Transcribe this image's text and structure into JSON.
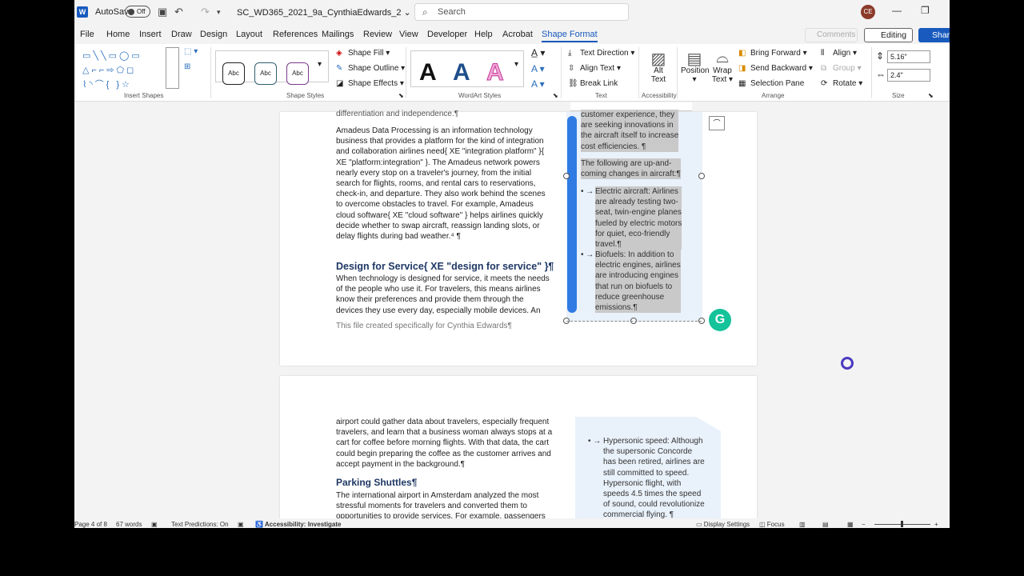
{
  "titlebar": {
    "autosave_label": "AutoSave",
    "autosave_state": "Off",
    "doc_title": "SC_WD365_2021_9a_CynthiaEdwards_2",
    "search_placeholder": "Search",
    "avatar_initials": "CE"
  },
  "tabs": [
    "File",
    "Home",
    "Insert",
    "Draw",
    "Design",
    "Layout",
    "References",
    "Mailings",
    "Review",
    "View",
    "Developer",
    "Help",
    "Acrobat",
    "Shape Format"
  ],
  "active_tab": "Shape Format",
  "tab_buttons": {
    "comments": "Comments",
    "editing": "Editing",
    "share": "Share"
  },
  "ribbon": {
    "groups": {
      "insert_shapes": "Insert Shapes",
      "shape_styles": "Shape Styles",
      "wordart_styles": "WordArt Styles",
      "text": "Text",
      "accessibility": "Accessibility",
      "arrange": "Arrange",
      "size": "Size"
    },
    "shape_style_samples": [
      "Abc",
      "Abc",
      "Abc"
    ],
    "shape_fill": "Shape Fill",
    "shape_outline": "Shape Outline",
    "shape_effects": "Shape Effects",
    "wordart_samples": [
      "A",
      "A",
      "A"
    ],
    "text_direction": "Text Direction",
    "align_text": "Align Text",
    "break_link": "Break Link",
    "alt_text": "Alt Text",
    "position": "Position",
    "wrap_text": "Wrap Text",
    "bring_forward": "Bring Forward",
    "send_backward": "Send Backward",
    "selection_pane": "Selection Pane",
    "align": "Align",
    "group": "Group",
    "rotate": "Rotate",
    "height": "5.16\"",
    "width": "2.4\""
  },
  "page1": {
    "top_cut": "differentiation and independence.¶",
    "para1": [
      "Amadeus Data Processing is an information technology",
      "business that provides a platform for the kind of integration",
      "and collaboration airlines need{ XE \"integration platform\" }{",
      "XE \"platform:integration\" }. The Amadeus network powers",
      "nearly every stop on a traveler's journey, from the initial",
      "search for flights, rooms, and rental cars to reservations,",
      "check-in, and departure. They also work behind the scenes",
      "to overcome obstacles to travel. For example, Amadeus",
      "cloud software{ XE \"cloud software\" } helps airlines quickly",
      "decide whether to swap aircraft, reassign landing slots, or",
      "delay flights during bad weather.⁴ ¶"
    ],
    "heading": "Design for Service{ XE \"design for service\" }¶",
    "para2": [
      "When technology is designed for service, it meets the needs",
      "of the people who use it. For travelers, this means airlines",
      "know their preferences and provide them through the",
      "devices they use every day, especially mobile devices. An"
    ],
    "footer": "This file created specifically for Cynthia Edwards¶",
    "sidebar": {
      "lines_top": [
        "customer experience, they",
        "are seeking innovations in",
        "the aircraft itself to increase",
        "cost efficiencies. ¶"
      ],
      "lines_intro": [
        "The following are up-and-",
        "coming changes in aircraft:¶"
      ],
      "bullet1": [
        "Electric aircraft: Airlines",
        "are already testing two-",
        "seat, twin-engine planes",
        "fueled by electric motors",
        "for quiet, eco-friendly",
        "travel.¶"
      ],
      "bullet2": [
        "Biofuels: In addition to",
        "electric engines, airlines",
        "are introducing engines",
        "that run on biofuels to",
        "reduce greenhouse",
        "emissions.¶"
      ],
      "bullet_marker": "• →"
    }
  },
  "page2": {
    "para1": [
      "airport could gather data about travelers, especially frequent",
      "travelers, and learn that a business woman always stops at a",
      "cart for coffee before morning flights. With that data, the cart",
      "could begin preparing the coffee as the customer arrives and",
      "accept payment in the background.¶"
    ],
    "heading": "Parking Shuttles¶",
    "para2": [
      "The international airport in Amsterdam analyzed the most",
      "stressful moments for travelers and converted them to",
      "opportunities to provide services. For example, passengers"
    ],
    "sidebar": {
      "bullet": [
        "Hypersonic speed: Although",
        "the supersonic Concorde",
        "has been retired, airlines are",
        "still committed to speed.",
        "Hypersonic flight, with",
        "speeds 4.5 times the speed",
        "of sound, could revolutionize",
        "commercial flying. ¶"
      ],
      "bullet_marker": "• →"
    }
  },
  "statusbar": {
    "page": "Page 4 of 8",
    "words": "67 words",
    "text_predictions": "Text Predictions: On",
    "accessibility": "Accessibility: Investigate",
    "display_settings": "Display Settings",
    "focus": "Focus"
  },
  "colors": {
    "accent": "#185abd",
    "sidebar_bg": "#e9f1fa",
    "heading": "#1f3864",
    "grammarly": "#15c39a"
  }
}
